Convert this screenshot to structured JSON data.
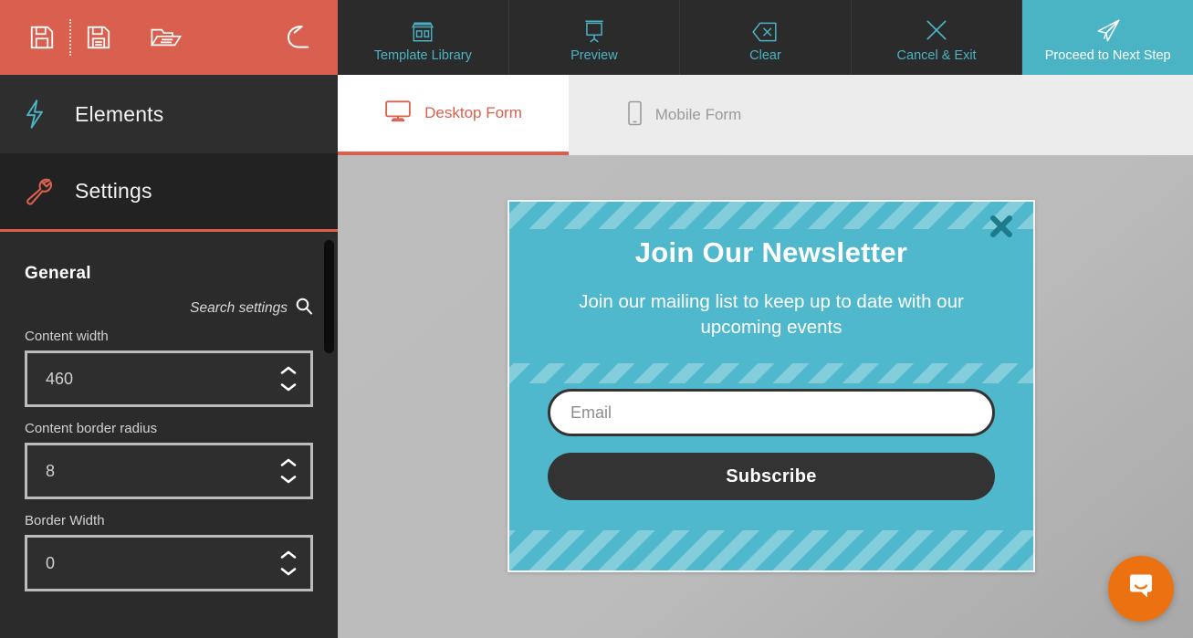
{
  "file_toolbar": {
    "buttons": [
      {
        "name": "save-icon",
        "label": "Save"
      },
      {
        "name": "save-as-icon",
        "label": "Save As"
      },
      {
        "name": "open-folder-icon",
        "label": "Open"
      },
      {
        "name": "undo-icon",
        "label": "Undo"
      }
    ],
    "accent_color": "#d9604f"
  },
  "top_nav": {
    "accent_color": "#4ab3c4",
    "items": [
      {
        "label": "Template Library",
        "icon": "template-library-icon",
        "active": false
      },
      {
        "label": "Preview",
        "icon": "preview-icon",
        "active": false
      },
      {
        "label": "Clear",
        "icon": "clear-icon",
        "active": false
      },
      {
        "label": "Cancel & Exit",
        "icon": "cancel-exit-icon",
        "active": false
      },
      {
        "label": "Proceed to Next Step",
        "icon": "proceed-icon",
        "active": true
      }
    ]
  },
  "sidebar": {
    "items": [
      {
        "label": "Elements",
        "icon": "lightning-bolt-icon",
        "icon_color": "#4ab3c4",
        "active": false
      },
      {
        "label": "Settings",
        "icon": "wrench-icon",
        "icon_color": "#d9604f",
        "active": true
      }
    ]
  },
  "settings": {
    "heading": "General",
    "search": {
      "label": "Search settings",
      "icon": "search-icon"
    },
    "fields": [
      {
        "label": "Content width",
        "value": "460"
      },
      {
        "label": "Content border radius",
        "value": "8"
      },
      {
        "label": "Border Width",
        "value": "0"
      }
    ]
  },
  "device_tabs": [
    {
      "label": "Desktop Form",
      "icon": "desktop-monitor-icon",
      "active": true
    },
    {
      "label": "Mobile Form",
      "icon": "mobile-phone-icon",
      "active": false
    }
  ],
  "popup": {
    "title": "Join Our Newsletter",
    "subtitle": "Join our mailing list to keep up to date with our upcoming events",
    "email_placeholder": "Email",
    "email_value": "",
    "subscribe_label": "Subscribe",
    "close_icon": "close-x-icon",
    "background_color": "#4fb8cc",
    "button_color": "#333333"
  },
  "chat_widget": {
    "icon": "chat-bubble-icon",
    "color": "#ec7211"
  }
}
